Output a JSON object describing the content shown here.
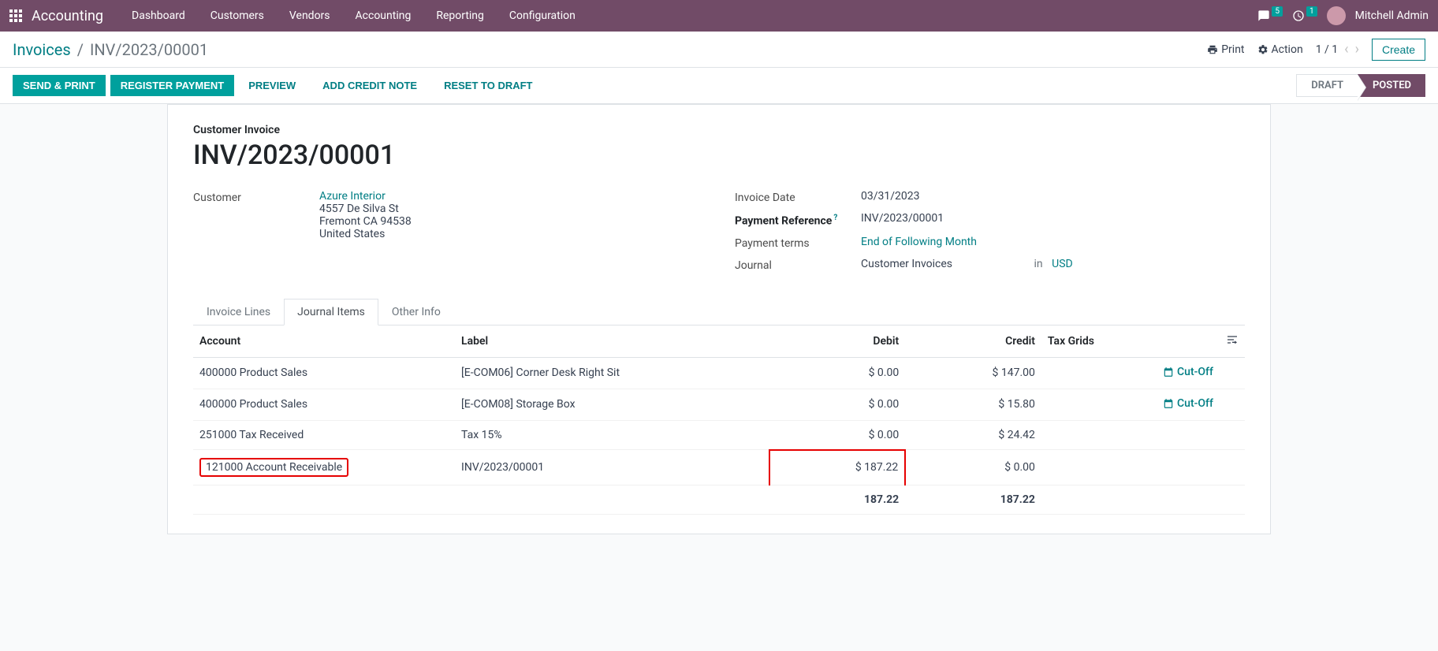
{
  "navbar": {
    "app_name": "Accounting",
    "menus": [
      "Dashboard",
      "Customers",
      "Vendors",
      "Accounting",
      "Reporting",
      "Configuration"
    ],
    "chat_badge": "5",
    "clock_badge": "1",
    "user_name": "Mitchell Admin"
  },
  "breadcrumb": {
    "parent": "Invoices",
    "current": "INV/2023/00001"
  },
  "cp": {
    "print": "Print",
    "action": "Action",
    "pager": "1 / 1",
    "create": "Create"
  },
  "buttons": {
    "send_print": "SEND & PRINT",
    "register_payment": "REGISTER PAYMENT",
    "preview": "PREVIEW",
    "add_credit_note": "ADD CREDIT NOTE",
    "reset_to_draft": "RESET TO DRAFT"
  },
  "status": {
    "draft": "DRAFT",
    "posted": "POSTED"
  },
  "form": {
    "title_label": "Customer Invoice",
    "title": "INV/2023/00001",
    "customer_label": "Customer",
    "customer_name": "Azure Interior",
    "addr1": "4557 De Silva St",
    "addr2": "Fremont CA 94538",
    "addr3": "United States",
    "invoice_date_label": "Invoice Date",
    "invoice_date": "03/31/2023",
    "payment_ref_label": "Payment Reference",
    "payment_ref": "INV/2023/00001",
    "payment_terms_label": "Payment terms",
    "payment_terms": "End of Following Month",
    "journal_label": "Journal",
    "journal": "Customer Invoices",
    "in": "in",
    "currency": "USD"
  },
  "tabs": {
    "invoice_lines": "Invoice Lines",
    "journal_items": "Journal Items",
    "other_info": "Other Info"
  },
  "table": {
    "headers": {
      "account": "Account",
      "label": "Label",
      "debit": "Debit",
      "credit": "Credit",
      "tax_grids": "Tax Grids"
    },
    "rows": [
      {
        "account": "400000 Product Sales",
        "label": "[E-COM06] Corner Desk Right Sit",
        "debit": "$ 0.00",
        "credit": "$ 147.00",
        "cutoff": "Cut-Off"
      },
      {
        "account": "400000 Product Sales",
        "label": "[E-COM08] Storage Box",
        "debit": "$ 0.00",
        "credit": "$ 15.80",
        "cutoff": "Cut-Off"
      },
      {
        "account": "251000 Tax Received",
        "label": "Tax 15%",
        "debit": "$ 0.00",
        "credit": "$ 24.42",
        "cutoff": ""
      },
      {
        "account": "121000 Account Receivable",
        "label": "INV/2023/00001",
        "debit": "$ 187.22",
        "credit": "$ 0.00",
        "cutoff": ""
      }
    ],
    "totals": {
      "debit": "187.22",
      "credit": "187.22"
    }
  }
}
